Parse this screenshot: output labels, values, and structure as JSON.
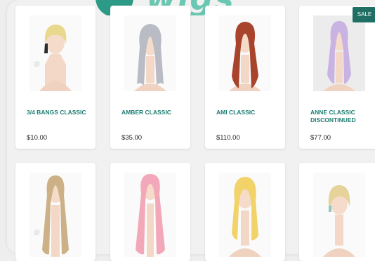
{
  "header": {
    "logo_text": "wigs"
  },
  "products": [
    {
      "name": "3/4 BANGS CLASSIC",
      "price": "$10.00",
      "wig_color": "#e9d98d",
      "icon": "mannequin-wig-blonde-bob"
    },
    {
      "name": "AMBER CLASSIC",
      "price": "$35.00",
      "wig_color": "#b9bcc4",
      "icon": "mannequin-wig-silver-long"
    },
    {
      "name": "AMI CLASSIC",
      "price": "$110.00",
      "wig_color": "#a8432c",
      "icon": "mannequin-wig-auburn-wavy"
    },
    {
      "name": "ANNE CLASSIC DISCONTINUED",
      "price": "$77.00",
      "wig_color": "#c9b3e3",
      "icon": "mannequin-wig-lavender",
      "badge": "SALE"
    },
    {
      "name": "",
      "price": "",
      "wig_color": "#cdb186",
      "icon": "mannequin-wig-ash-blonde-curly"
    },
    {
      "name": "",
      "price": "",
      "wig_color": "#f2a8b8",
      "icon": "mannequin-wig-pink-curly"
    },
    {
      "name": "",
      "price": "",
      "wig_color": "#f1d36a",
      "icon": "mannequin-wig-yellow-long"
    },
    {
      "name": "",
      "price": "",
      "wig_color": "#e6d39a",
      "icon": "mannequin-wig-pastel-bob"
    }
  ],
  "colors": {
    "accent": "#1d7e72",
    "sale_badge": "#1f6f65"
  }
}
